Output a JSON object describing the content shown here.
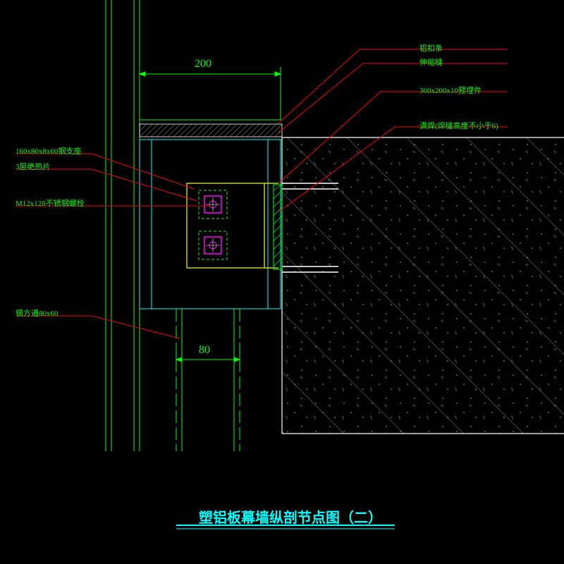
{
  "title": "塑铝板幕墙纵剖节点图（二）",
  "dims": {
    "d200": "200",
    "d80": "80"
  },
  "labels": {
    "l1": "铝扣条",
    "l2": "伸缩缝",
    "l3": "300x200x10预埋件",
    "l4": "满焊(焊缝高度不小于6)",
    "l5": "160x80x8x60钢支座",
    "l6": "3层绝热片",
    "l7": "M12x120不锈钢螺栓",
    "l8": "钢方通80x60"
  }
}
